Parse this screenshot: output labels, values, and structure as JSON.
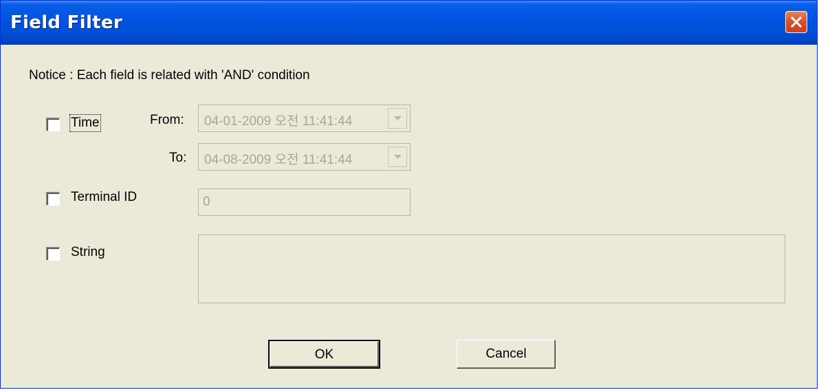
{
  "window": {
    "title": "Field Filter",
    "close_icon": "close-icon"
  },
  "notice": "Notice : Each field is related with 'AND' condition",
  "time": {
    "label": "Time",
    "checked": false,
    "from_label": "From:",
    "from_value": "04-01-2009 오전 11:41:44",
    "to_label": "To:",
    "to_value": "04-08-2009 오전 11:41:44"
  },
  "terminal_id": {
    "label": "Terminal ID",
    "checked": false,
    "value": "0"
  },
  "string": {
    "label": "String",
    "checked": false,
    "value": ""
  },
  "buttons": {
    "ok": "OK",
    "cancel": "Cancel"
  },
  "colors": {
    "titlebar": "#0054e3",
    "dialog_bg": "#ece9d8",
    "disabled_text": "#a7a694",
    "close_button": "#d8532d"
  }
}
